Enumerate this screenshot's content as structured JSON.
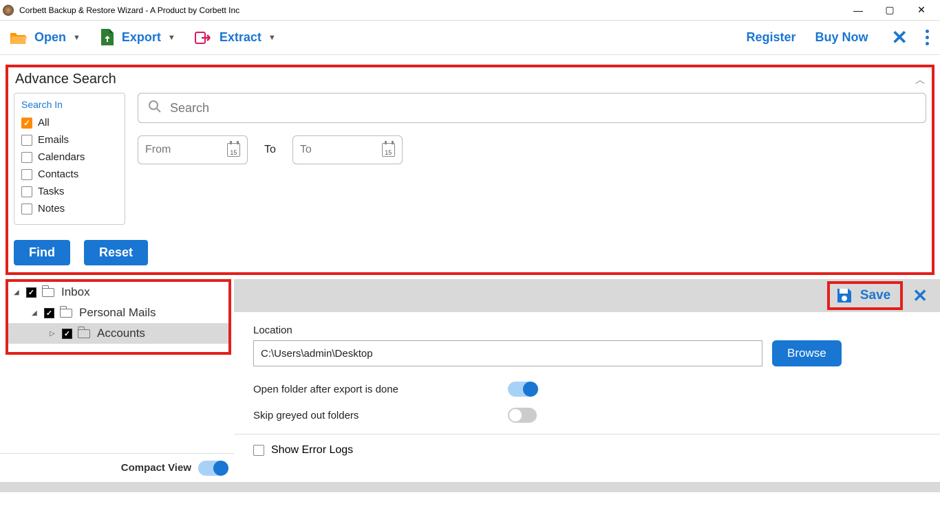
{
  "window": {
    "title": "Corbett Backup & Restore Wizard - A Product by Corbett Inc"
  },
  "toolbar": {
    "open": "Open",
    "export": "Export",
    "extract": "Extract",
    "register": "Register",
    "buy_now": "Buy Now"
  },
  "adv": {
    "title": "Advance Search",
    "search_in_label": "Search In",
    "items": [
      {
        "label": "All",
        "checked": true
      },
      {
        "label": "Emails",
        "checked": false
      },
      {
        "label": "Calendars",
        "checked": false
      },
      {
        "label": "Contacts",
        "checked": false
      },
      {
        "label": "Tasks",
        "checked": false
      },
      {
        "label": "Notes",
        "checked": false
      }
    ],
    "search_placeholder": "Search",
    "from_placeholder": "From",
    "to_label": "To",
    "to_placeholder": "To",
    "find": "Find",
    "reset": "Reset"
  },
  "tree": {
    "inbox": "Inbox",
    "personal": "Personal Mails",
    "accounts": "Accounts"
  },
  "compact_label": "Compact View",
  "save_label": "Save",
  "settings": {
    "location_label": "Location",
    "location_value": "C:\\Users\\admin\\Desktop",
    "browse": "Browse",
    "open_after": "Open folder after export is done",
    "skip_grey": "Skip greyed out folders",
    "show_err": "Show Error Logs"
  }
}
